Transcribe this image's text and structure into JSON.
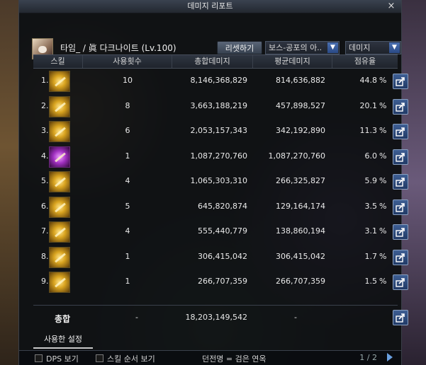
{
  "window": {
    "title": "데미지 리포트",
    "close_label": "×"
  },
  "character": {
    "name": "타임_ / 眞 다크나이트 (Lv.100)"
  },
  "controls": {
    "reset_label": "리셋하기",
    "boss_select": "보스-공포의 아..",
    "type_select": "데미지"
  },
  "table": {
    "headers": {
      "skill": "스킬",
      "count": "사용횟수",
      "total": "총합데미지",
      "avg": "평균데미지",
      "share": "점유율"
    },
    "rows": [
      {
        "idx": "1.",
        "icon": "skill-icon",
        "count": "10",
        "total": "8,146,368,829",
        "avg": "814,636,882",
        "share": "44.8",
        "unit": "%"
      },
      {
        "idx": "2.",
        "icon": "skill-icon",
        "count": "8",
        "total": "3,663,188,219",
        "avg": "457,898,527",
        "share": "20.1",
        "unit": "%"
      },
      {
        "idx": "3.",
        "icon": "skill-icon",
        "count": "6",
        "total": "2,053,157,343",
        "avg": "342,192,890",
        "share": "11.3",
        "unit": "%"
      },
      {
        "idx": "4.",
        "icon": "skill-icon-purple",
        "count": "1",
        "total": "1,087,270,760",
        "avg": "1,087,270,760",
        "share": "6.0",
        "unit": "%"
      },
      {
        "idx": "5.",
        "icon": "skill-icon",
        "count": "4",
        "total": "1,065,303,310",
        "avg": "266,325,827",
        "share": "5.9",
        "unit": "%"
      },
      {
        "idx": "6.",
        "icon": "skill-icon",
        "count": "5",
        "total": "645,820,874",
        "avg": "129,164,174",
        "share": "3.5",
        "unit": "%"
      },
      {
        "idx": "7.",
        "icon": "skill-icon",
        "count": "4",
        "total": "555,440,779",
        "avg": "138,860,194",
        "share": "3.1",
        "unit": "%"
      },
      {
        "idx": "8.",
        "icon": "skill-icon",
        "count": "1",
        "total": "306,415,042",
        "avg": "306,415,042",
        "share": "1.7",
        "unit": "%"
      },
      {
        "idx": "9.",
        "icon": "skill-icon",
        "count": "1",
        "total": "266,707,359",
        "avg": "266,707,359",
        "share": "1.5",
        "unit": "%"
      }
    ],
    "total_row": {
      "label": "총합",
      "count": "-",
      "total": "18,203,149,542",
      "avg": "-"
    }
  },
  "settings_tab": "사용한 설정",
  "bottom": {
    "dps_label": "DPS 보기",
    "order_label": "스킬 순서 보기",
    "tip": "던전명 = 검은 연옥",
    "page": "1 / 2"
  }
}
